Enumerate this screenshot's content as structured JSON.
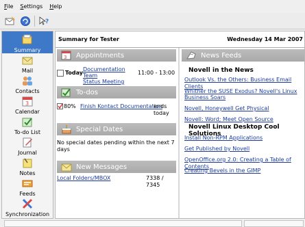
{
  "menubar": {
    "items": [
      {
        "mnemonic": "F",
        "rest": "ile"
      },
      {
        "mnemonic": "S",
        "rest": "ettings"
      },
      {
        "mnemonic": "H",
        "rest": "elp"
      }
    ]
  },
  "sidebar": {
    "items": [
      {
        "label": "Summary",
        "icon": "summary-icon",
        "active": true
      },
      {
        "label": "Mail",
        "icon": "mail-icon"
      },
      {
        "label": "Contacts",
        "icon": "contacts-icon"
      },
      {
        "label": "Calendar",
        "icon": "calendar-icon"
      },
      {
        "label": "To-do List",
        "icon": "todo-icon"
      },
      {
        "label": "Journal",
        "icon": "journal-icon"
      },
      {
        "label": "Notes",
        "icon": "notes-icon"
      },
      {
        "label": "Feeds",
        "icon": "feeds-icon"
      },
      {
        "label": "Synchronization",
        "icon": "sync-icon"
      }
    ]
  },
  "summary": {
    "title": "Summary for Tester",
    "date": "Wednesday 14 Mar 2007",
    "appointments": {
      "heading": "Appointments",
      "day": "Today",
      "link_line1": "Documentation Team",
      "link_line2": "Status Meeting",
      "time": "11:00 - 13:00"
    },
    "todos": {
      "heading": "To-dos",
      "percent": "80%",
      "link": "Finish Kontact Documentation",
      "due": "ends today"
    },
    "special_dates": {
      "heading": "Special Dates",
      "text": "No special dates pending within the next 7 days"
    },
    "new_messages": {
      "heading": "New Messages",
      "folder": "Local Folders/MBOX",
      "count": "7338 / 7345"
    },
    "news_feeds": {
      "heading": "News Feeds",
      "feeds": [
        {
          "title": "Novell in the News",
          "items": [
            "Outlook Vs. the Others: Business Email Clients",
            "Whither the SUSE Exodus? Novell's Linux",
            "Business Soars",
            "Novell, Honeywell Get Physical",
            "Novell: Word; Meet Open Source"
          ]
        },
        {
          "title": "Novell Linux Desktop Cool Solutions",
          "items": [
            "Install Non-RPM Applications",
            "Get Published by Novell",
            "OpenOffice.org 2.0: Creating a Table of Contents",
            "Creating Bevels in the GIMP"
          ]
        }
      ]
    }
  },
  "colors": {
    "accent": "#3d78c9",
    "link": "#1a3a9e",
    "section_header": "#b0b0b0"
  }
}
